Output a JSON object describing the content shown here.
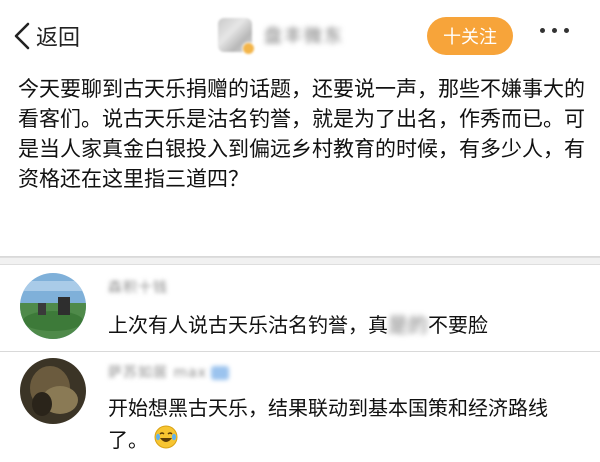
{
  "topbar": {
    "back_label": "返回",
    "author_name": "盘丰微东",
    "follow_label": "十关注"
  },
  "post": {
    "text": "今天要聊到古天乐捐赠的话题，还要说一声，那些不嫌事大的看客们。说古天乐是沽名钓誉，就是为了出名，作秀而已。可是当人家真金白银投入到偏远乡村教育的时候，有多少人，有资格还在这里指三道四？"
  },
  "comments": [
    {
      "username": "森积十钱",
      "text_before": "上次有人说古天乐沽名钓誉，真",
      "text_blurred": "是的",
      "text_after": "不要脸"
    },
    {
      "username": "萨苏如居 max",
      "text": "开始想黑古天乐，结果联动到基本国策和经济路线了。",
      "emoji": "laughing-tears-emoji"
    }
  ],
  "colors": {
    "accent": "#f7a43a",
    "divider": "#d9d9d9",
    "text": "#111111",
    "muted": "#8a8a8a"
  }
}
